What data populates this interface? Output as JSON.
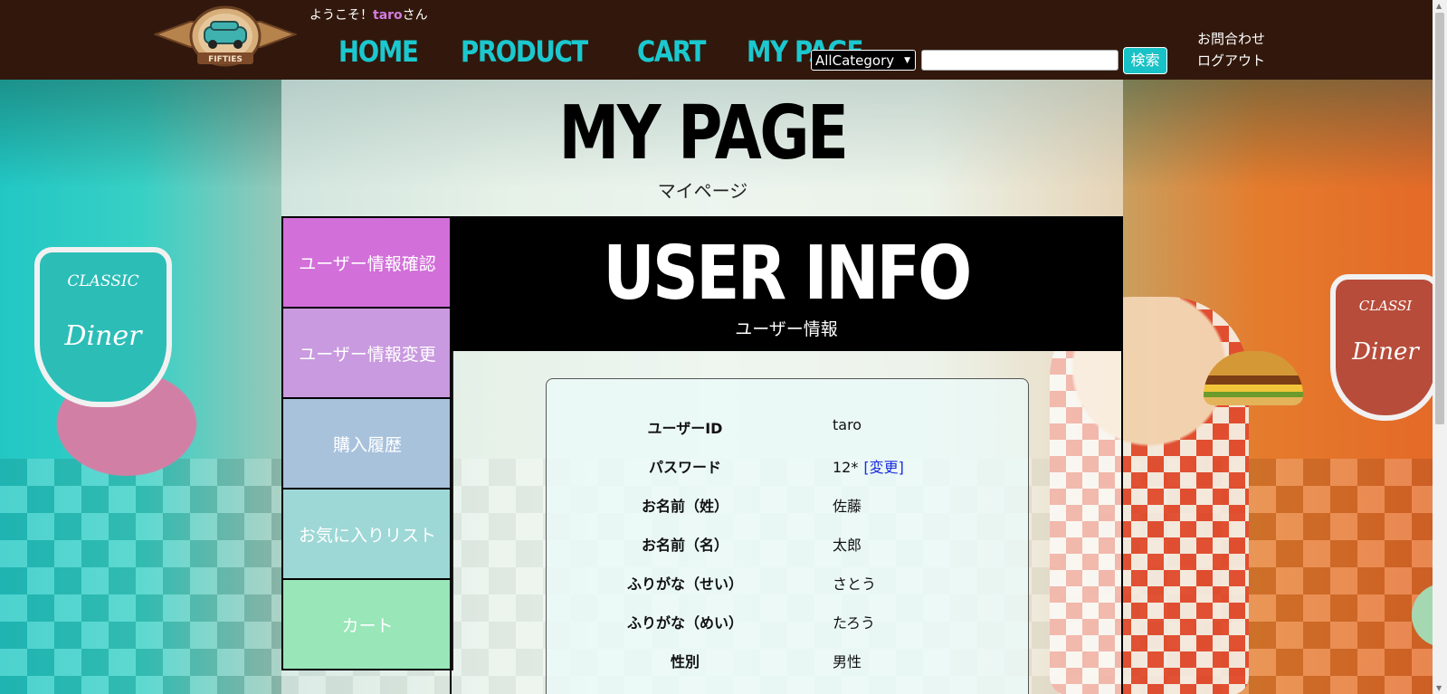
{
  "header": {
    "welcome_prefix": "ようこそ！",
    "username": "taro",
    "welcome_suffix": "さん",
    "logo_text": "FIFTIES",
    "nav": [
      "HOME",
      "PRODUCT",
      "CART",
      "MY PAGE"
    ],
    "category_selected": "AllCategory",
    "search_value": "",
    "search_button": "検索",
    "contact_link": "お問合わせ",
    "logout_link": "ログアウト"
  },
  "page": {
    "title": "MY PAGE",
    "subtitle": "マイページ"
  },
  "sidebar": {
    "items": [
      {
        "label": "ユーザー情報確認",
        "color": "#d26fd9"
      },
      {
        "label": "ユーザー情報変更",
        "color": "#c99adf"
      },
      {
        "label": "購入履歴",
        "color": "#a8c2dc"
      },
      {
        "label": "お気に入りリスト",
        "color": "#9ed8d6"
      },
      {
        "label": "カート",
        "color": "#99e6b9"
      }
    ]
  },
  "content": {
    "title": "USER INFO",
    "subtitle": "ユーザー情報",
    "rows": [
      {
        "label": "ユーザーID",
        "value": "taro"
      },
      {
        "label": "パスワード",
        "value": "12*",
        "action": "[変更]"
      },
      {
        "label": "お名前（姓）",
        "value": "佐藤"
      },
      {
        "label": "お名前（名）",
        "value": "太郎"
      },
      {
        "label": "ふりがな（せい）",
        "value": "さとう"
      },
      {
        "label": "ふりがな（めい）",
        "value": "たろう"
      },
      {
        "label": "性別",
        "value": "男性"
      }
    ]
  },
  "background": {
    "sign_left_top": "CLASSIC",
    "sign_left_bottom": "Diner",
    "sign_right_top": "CLASSI",
    "sign_right_bottom": "Diner"
  },
  "colors": {
    "header_bg": "#32180c",
    "nav_accent": "#1bc8cf",
    "username_accent": "#d27be0",
    "link_blue": "#1b2ee0"
  }
}
